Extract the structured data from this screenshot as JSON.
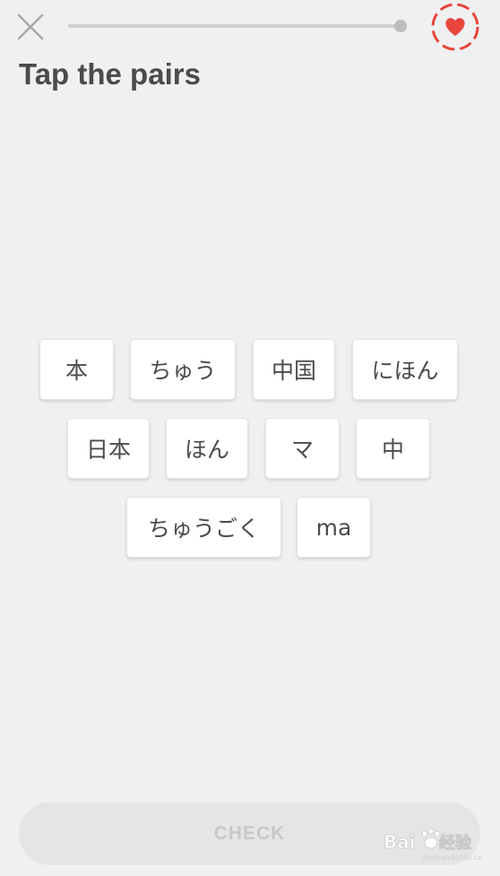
{
  "header": {
    "close_icon": "close-icon",
    "progress_value": 1.0,
    "hearts_icon": "heart-icon",
    "hearts_color": "#e8453c"
  },
  "title": "Tap the pairs",
  "tiles": [
    "本",
    "ちゅう",
    "中国",
    "にほん",
    "日本",
    "ほん",
    "マ",
    "中",
    "ちゅうごく",
    "ma"
  ],
  "check_button": {
    "label": "CHECK",
    "enabled": false
  },
  "watermark": {
    "brand": "Baidu 经验"
  },
  "colors": {
    "background": "#f0f0f0",
    "text": "#4b4b4b",
    "tile": "#ffffff",
    "disabled_button": "#e5e5e5",
    "disabled_text": "#c7c7c7"
  }
}
